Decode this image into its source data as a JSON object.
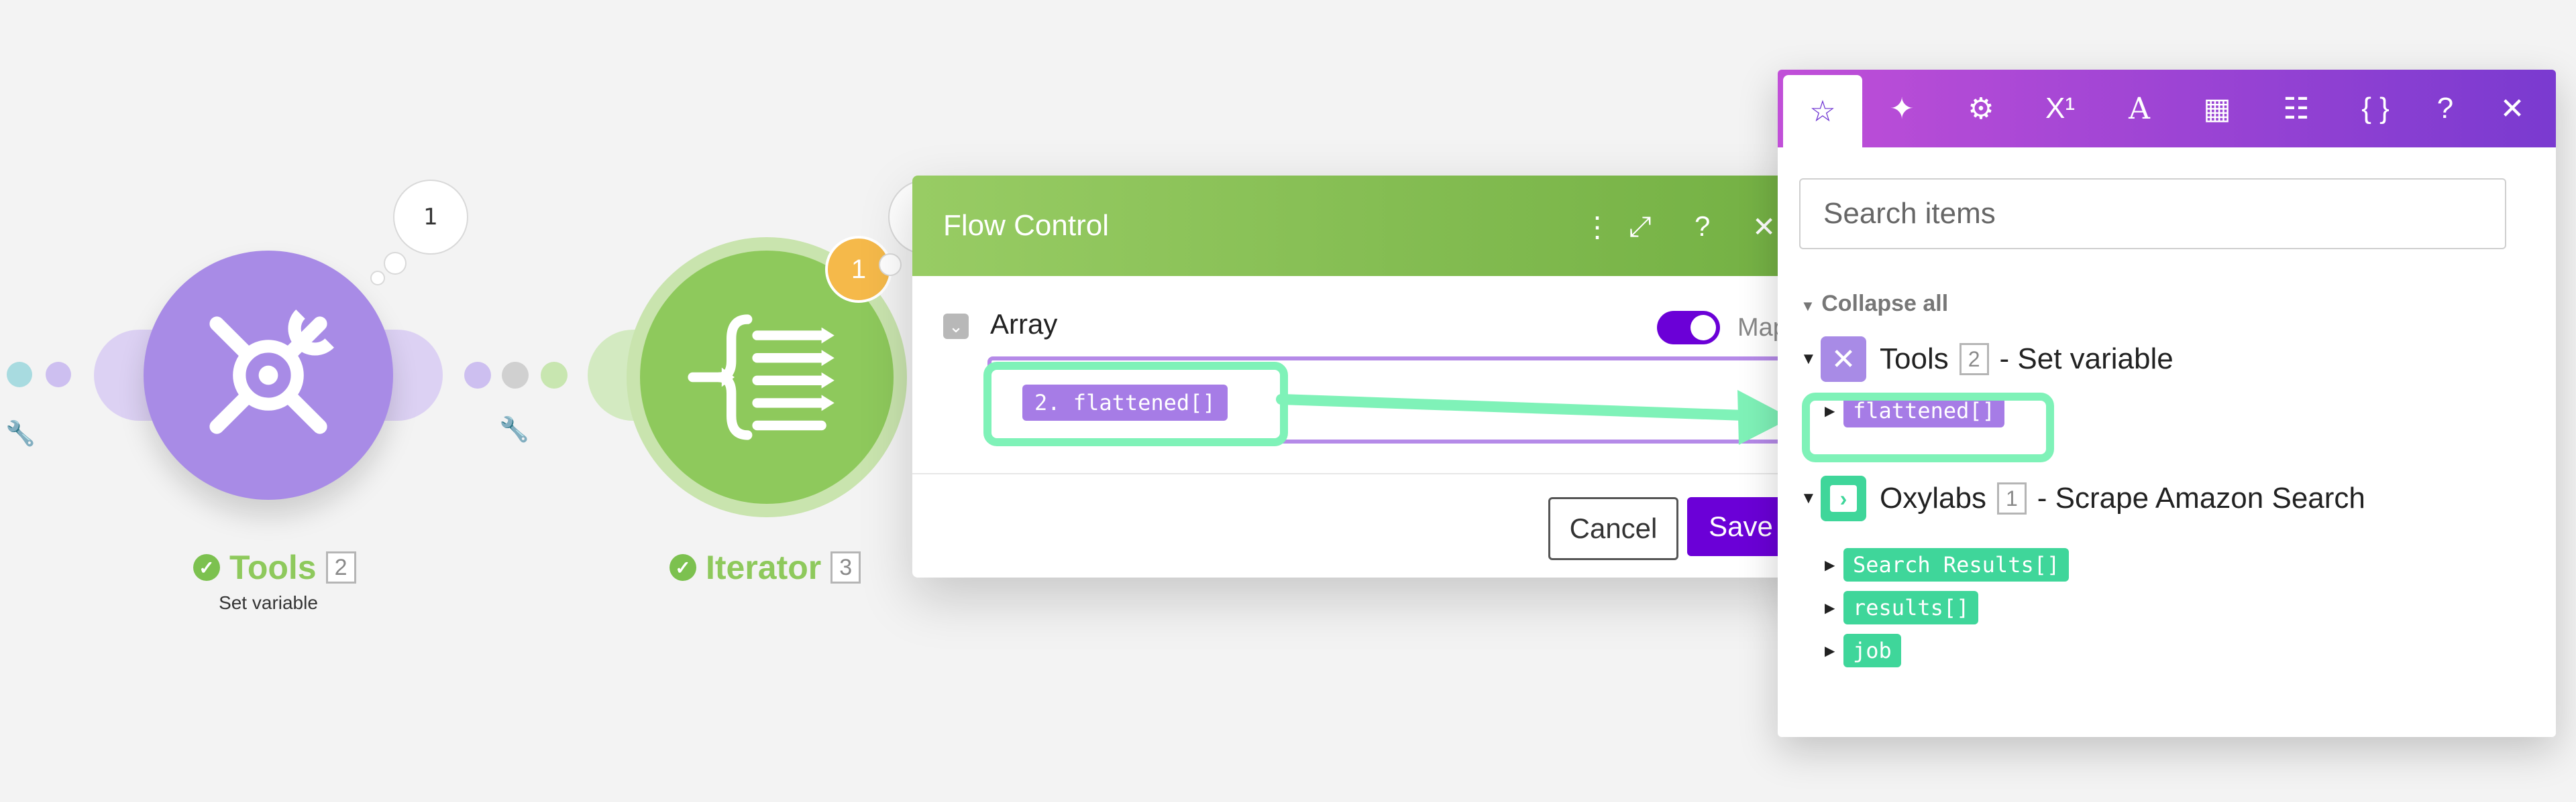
{
  "canvas": {
    "bubble1": "1",
    "bubble2": "1",
    "tools_module": {
      "name": "Tools",
      "id": "2",
      "subtitle": "Set variable",
      "color": "#a88be6"
    },
    "iterator_module": {
      "name": "Iterator",
      "id": "3",
      "color": "#8ec95c"
    }
  },
  "dialog": {
    "title": "Flow Control",
    "field_label": "Array",
    "map_label": "Map",
    "array_value": "2. flattened[]",
    "cancel_label": "Cancel",
    "save_label": "Save"
  },
  "panel": {
    "tabs": [
      "star-icon",
      "sparkle-icon",
      "gear-icon",
      "superscript-icon",
      "text-icon",
      "calendar-icon",
      "table-icon",
      "braces-icon"
    ],
    "tab_glyphs": {
      "superscript": "X¹",
      "text": "A",
      "braces": "{ }",
      "help": "?",
      "close": "✕"
    },
    "search_placeholder": "Search items",
    "collapse_all": "Collapse all",
    "tools_group": {
      "app": "Tools",
      "id": "2",
      "desc": "- Set variable",
      "items": [
        "flattened[]"
      ]
    },
    "oxylabs_group": {
      "app": "Oxylabs",
      "id": "1",
      "desc": "- Scrape Amazon Search",
      "items": [
        "Search Results[]",
        "results[]",
        "job"
      ]
    }
  }
}
